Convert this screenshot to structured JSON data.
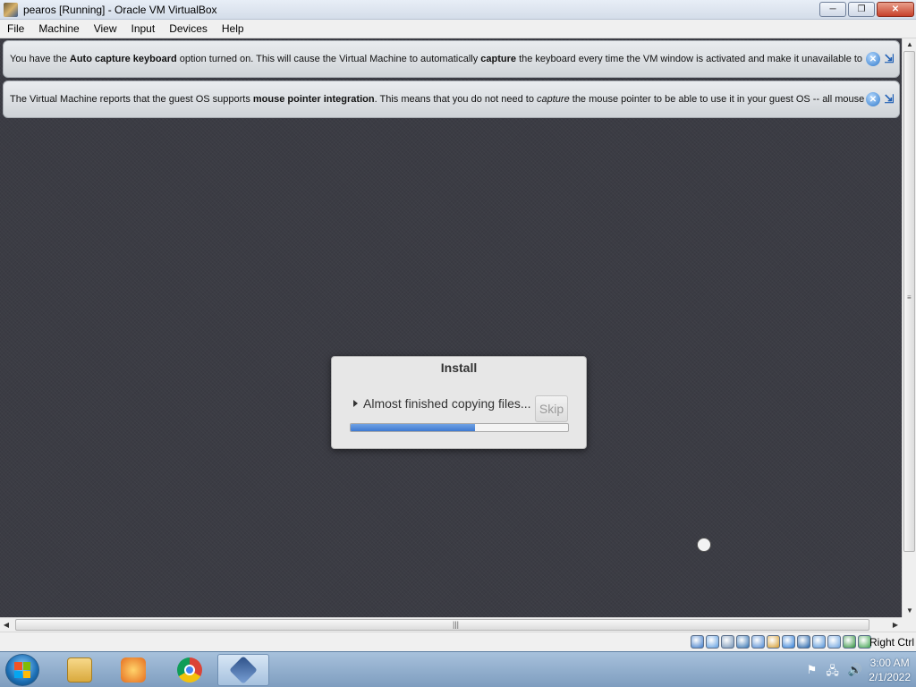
{
  "window": {
    "title": "pearos [Running] - Oracle VM VirtualBox",
    "minimize_label": "─",
    "maximize_label": "❐",
    "close_label": "✕"
  },
  "menu": [
    "File",
    "Machine",
    "View",
    "Input",
    "Devices",
    "Help"
  ],
  "notifications": [
    {
      "pre": "You have the ",
      "bold1": "Auto capture keyboard",
      "mid1": " option turned on. This will cause the Virtual Machine to automatically ",
      "bold2": "capture",
      "post": " the keyboard every time the VM window is activated and make it unavailable to"
    },
    {
      "pre": "The Virtual Machine reports that the guest OS supports ",
      "bold1": "mouse pointer integration",
      "mid1": ". This means that you do not need to ",
      "italic": "capture",
      "post": " the mouse pointer to be able to use it in your guest OS -- all mouse"
    }
  ],
  "notification_close_glyph": "✕",
  "notification_dismiss_glyph": "⇲",
  "install_dialog": {
    "title": "Install",
    "status": "Almost finished copying files...",
    "skip_label": "Skip",
    "progress": 0.57
  },
  "status_bar": {
    "host_key": "Right Ctrl",
    "icons": [
      "hard-disk-icon",
      "optical-drive-icon",
      "audio-icon",
      "network-icon",
      "usb-icon",
      "shared-folders-icon",
      "display-icon",
      "video-capture-icon",
      "graphics-icon",
      "cpu-icon",
      "mouse-integration-icon",
      "keyboard-capture-icon"
    ]
  },
  "taskbar": {
    "apps": [
      "file-explorer-icon",
      "media-player-icon",
      "chrome-icon",
      "virtualbox-icon"
    ],
    "tray": [
      "action-center-flag-icon",
      "network-icon",
      "volume-icon"
    ],
    "time": "3:00 AM",
    "date": "2/1/2022"
  },
  "colors": {
    "progress_fill": "#3e7ad1",
    "vm_background": "#3b3c44"
  }
}
